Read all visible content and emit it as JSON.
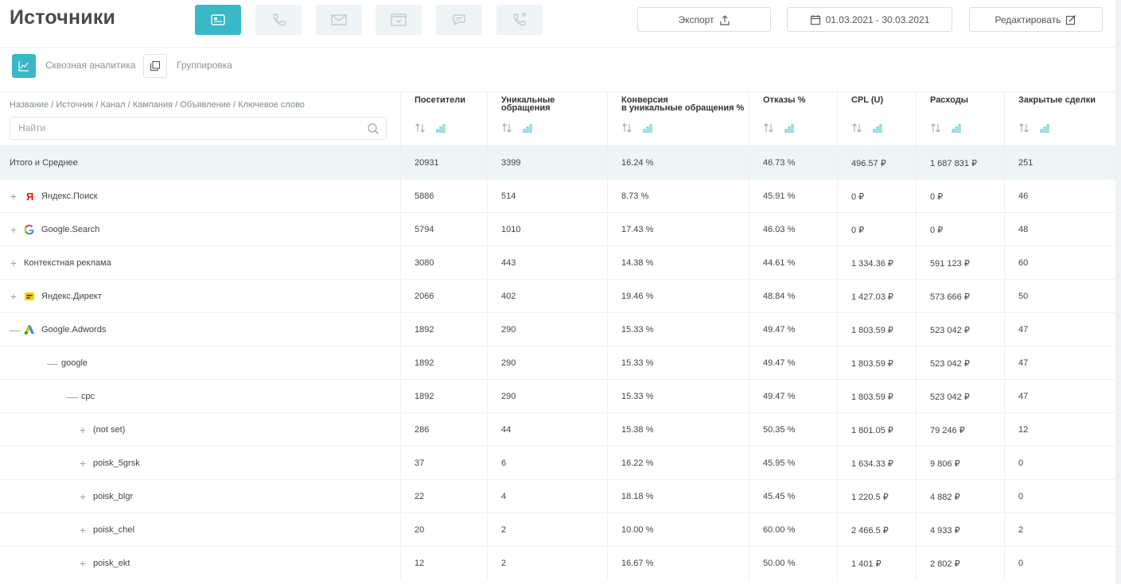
{
  "page": {
    "title": "Источники"
  },
  "type_buttons": [
    {
      "name": "all-sources",
      "icon": "cards-icon",
      "active": true
    },
    {
      "name": "calls",
      "icon": "phone-icon",
      "active": false
    },
    {
      "name": "email",
      "icon": "envelope-icon",
      "active": false
    },
    {
      "name": "forms",
      "icon": "form-icon",
      "active": false
    },
    {
      "name": "chat",
      "icon": "chat-icon",
      "active": false
    },
    {
      "name": "callback",
      "icon": "phone-callback-icon",
      "active": false
    }
  ],
  "actions": {
    "export_label": "Экспорт",
    "date_range": "01.03.2021 - 30.03.2021",
    "edit_label": "Редактировать"
  },
  "toolbar": {
    "analytics_label": "Сквозная аналитика",
    "grouping_label": "Группировка"
  },
  "table": {
    "name_header": "Название / Источник / Канал / Кампания / Объявление / Ключевое слово",
    "search_placeholder": "Найти",
    "columns": [
      {
        "title": "Посетители"
      },
      {
        "title": "Уникальные\nобращения"
      },
      {
        "title": "Конверсия\nв уникальные обращения %"
      },
      {
        "title": "Отказы %"
      },
      {
        "title": "CPL (U)"
      },
      {
        "title": "Расходы"
      },
      {
        "title": "Закрытые сделки"
      }
    ],
    "rows": [
      {
        "name": "Итого и Среднее",
        "level": 0,
        "expand": "",
        "icon": "",
        "total": true,
        "values": [
          "20931",
          "3399",
          "16.24 %",
          "46.73 %",
          "496.57 ₽",
          "1 687 831 ₽",
          "251"
        ]
      },
      {
        "name": "Яндекс.Поиск",
        "level": 0,
        "expand": "+",
        "icon": "yandex-icon",
        "values": [
          "5886",
          "514",
          "8.73 %",
          "45.91 %",
          "0 ₽",
          "0 ₽",
          "46"
        ]
      },
      {
        "name": "Google.Search",
        "level": 0,
        "expand": "+",
        "icon": "google-icon",
        "values": [
          "5794",
          "1010",
          "17.43 %",
          "46.03 %",
          "0 ₽",
          "0 ₽",
          "48"
        ]
      },
      {
        "name": "Контекстная реклама",
        "level": 0,
        "expand": "+",
        "icon": "",
        "values": [
          "3080",
          "443",
          "14.38 %",
          "44.61 %",
          "1 334.36 ₽",
          "591 123 ₽",
          "60"
        ]
      },
      {
        "name": "Яндекс.Директ",
        "level": 0,
        "expand": "+",
        "icon": "yandex-direct-icon",
        "values": [
          "2066",
          "402",
          "19.46 %",
          "48.84 %",
          "1 427.03 ₽",
          "573 666 ₽",
          "50"
        ]
      },
      {
        "name": "Google.Adwords",
        "level": 0,
        "expand": "—",
        "icon": "google-ads-icon",
        "values": [
          "1892",
          "290",
          "15.33 %",
          "49.47 %",
          "1 803.59 ₽",
          "523 042 ₽",
          "47"
        ]
      },
      {
        "name": "google",
        "level": 1,
        "expand": "—",
        "icon": "",
        "values": [
          "1892",
          "290",
          "15.33 %",
          "49.47 %",
          "1 803.59 ₽",
          "523 042 ₽",
          "47"
        ]
      },
      {
        "name": "cpc",
        "level": 2,
        "expand": "—",
        "icon": "",
        "values": [
          "1892",
          "290",
          "15.33 %",
          "49.47 %",
          "1 803.59 ₽",
          "523 042 ₽",
          "47"
        ]
      },
      {
        "name": "(not set)",
        "level": 3,
        "expand": "+",
        "icon": "",
        "values": [
          "286",
          "44",
          "15.38 %",
          "50.35 %",
          "1 801.05 ₽",
          "79 246 ₽",
          "12"
        ]
      },
      {
        "name": "poisk_5grsk",
        "level": 3,
        "expand": "+",
        "icon": "",
        "values": [
          "37",
          "6",
          "16.22 %",
          "45.95 %",
          "1 634.33 ₽",
          "9 806 ₽",
          "0"
        ]
      },
      {
        "name": "poisk_blgr",
        "level": 3,
        "expand": "+",
        "icon": "",
        "values": [
          "22",
          "4",
          "18.18 %",
          "45.45 %",
          "1 220.5 ₽",
          "4 882 ₽",
          "0"
        ]
      },
      {
        "name": "poisk_chel",
        "level": 3,
        "expand": "+",
        "icon": "",
        "values": [
          "20",
          "2",
          "10.00 %",
          "60.00 %",
          "2 466.5 ₽",
          "4 933 ₽",
          "2"
        ]
      },
      {
        "name": "poisk_ekt",
        "level": 3,
        "expand": "+",
        "icon": "",
        "values": [
          "12",
          "2",
          "16.67 %",
          "50.00 %",
          "1 401 ₽",
          "2 802 ₽",
          "0"
        ]
      }
    ]
  },
  "colors": {
    "accent": "#39b8c8",
    "total_row_bg": "#eef5f6"
  }
}
